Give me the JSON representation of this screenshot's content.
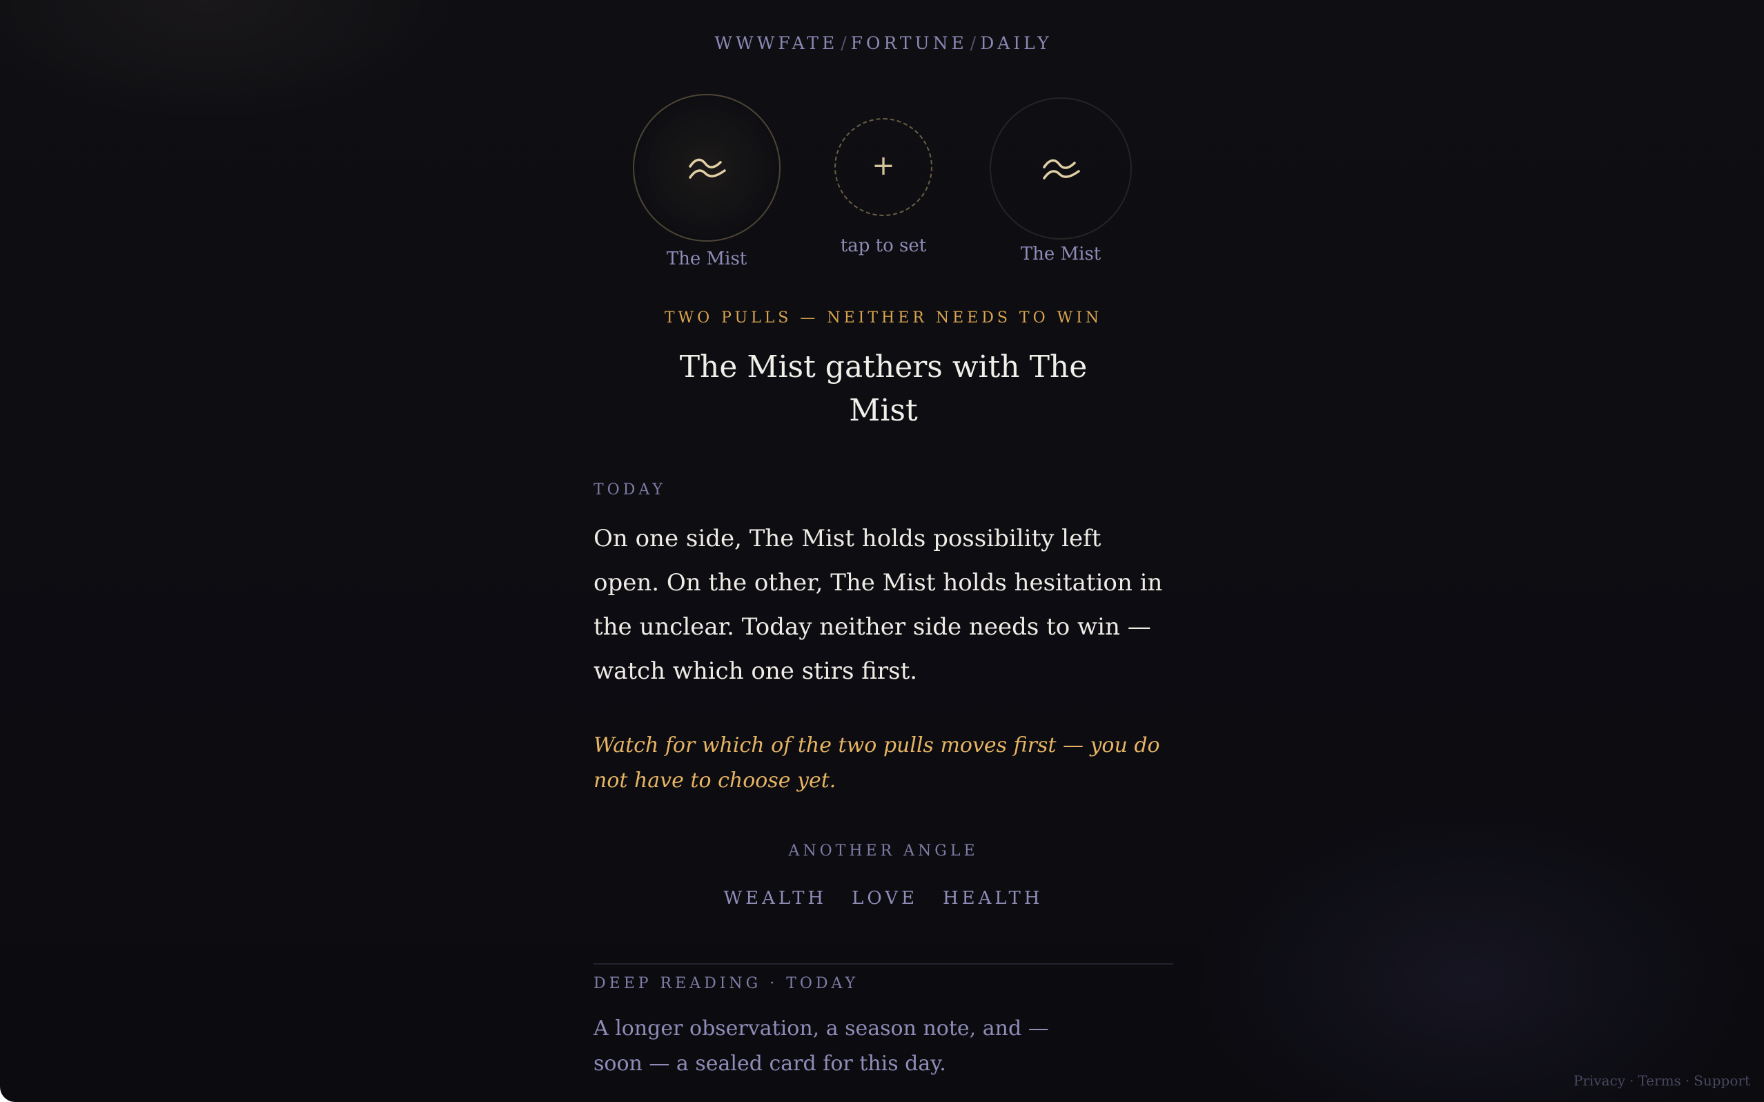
{
  "breadcrumb": [
    "WWWFATE",
    "FORTUNE",
    "DAILY"
  ],
  "breadcrumb_separator": "/",
  "pulls": {
    "left": {
      "label": "The Mist",
      "icon": "mist-icon"
    },
    "center": {
      "plus": "+",
      "label": "tap to set",
      "icon": "plus-icon"
    },
    "right": {
      "label": "The Mist",
      "icon": "mist-icon"
    }
  },
  "tagline": "TWO PULLS — NEITHER NEEDS TO WIN",
  "title": "The Mist gathers with The Mist",
  "today": {
    "label": "TODAY",
    "body": "On one side, The Mist holds possibility left open. On the other, The Mist holds hesitation in the unclear. Today neither side needs to win — watch which one stirs first.",
    "advice": "Watch for which of the two pulls moves first — you do not have to choose yet."
  },
  "another_angle": {
    "label": "ANOTHER ANGLE",
    "options": [
      "WEALTH",
      "LOVE",
      "HEALTH"
    ]
  },
  "deep_reading": {
    "label": "DEEP READING · TODAY",
    "text": "A longer observation, a season note, and — soon — a sealed card for this day."
  },
  "footer": {
    "links": [
      "Privacy",
      "Terms",
      "Support"
    ],
    "separator": "·"
  },
  "colors": {
    "background": "#0d0d12",
    "accent_gold": "#d9a54e",
    "muted_violet": "#8f8cb8",
    "text": "#efece6"
  }
}
